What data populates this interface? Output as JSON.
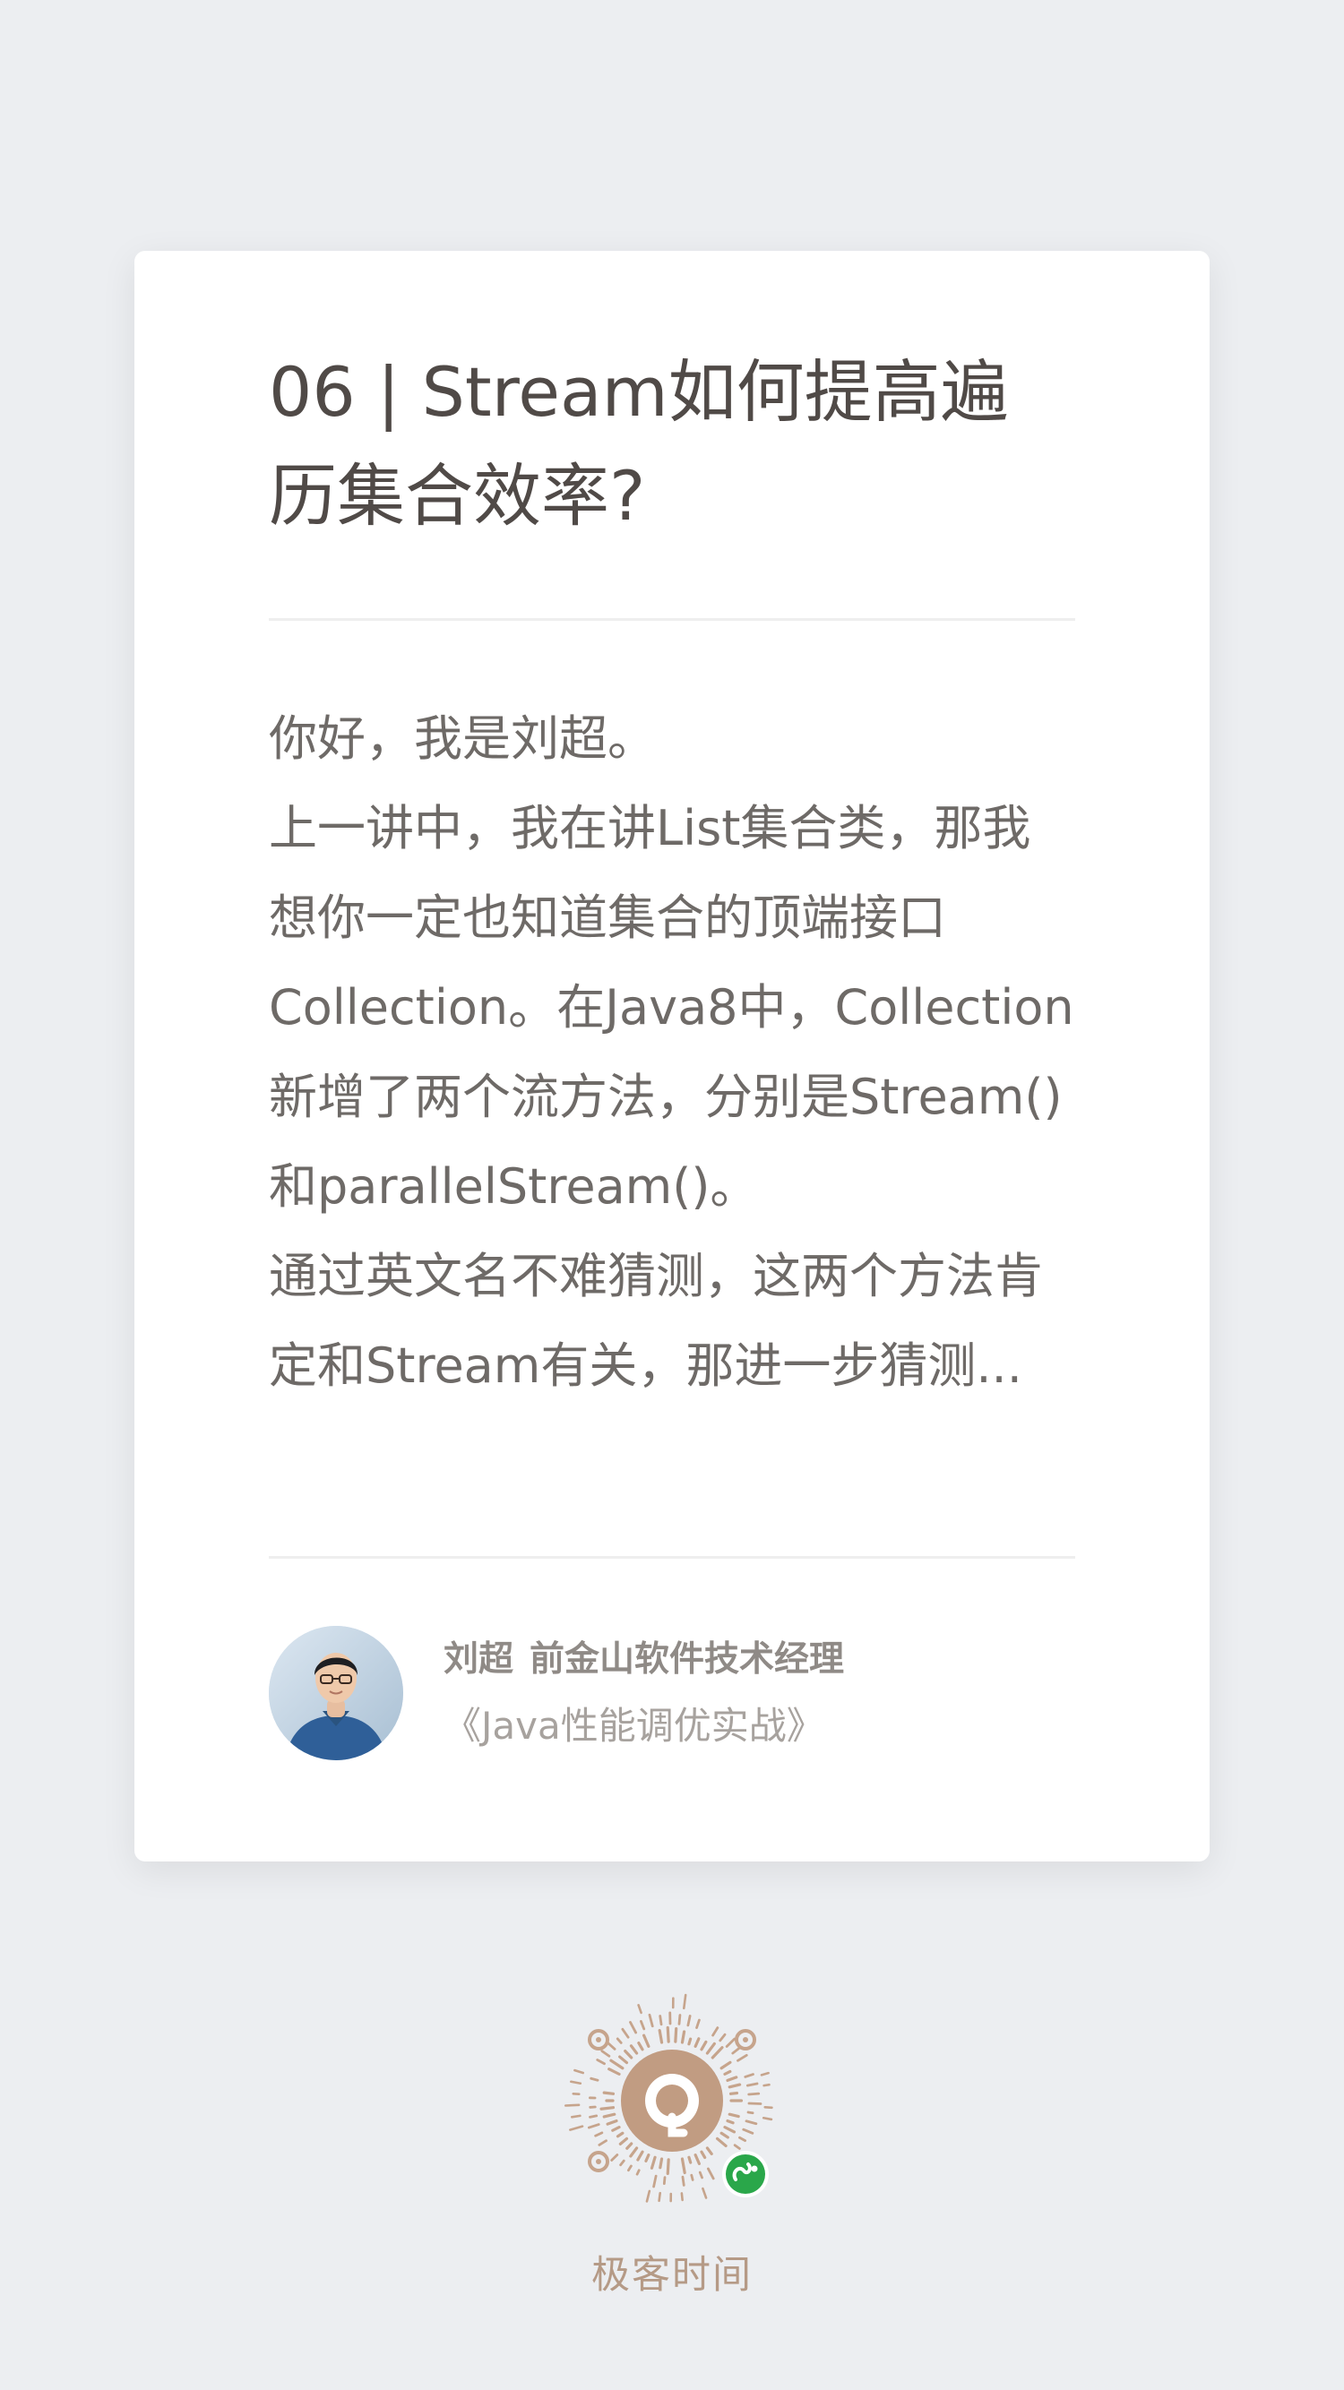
{
  "card": {
    "title": "06 | Stream如何提高遍\n历集合效率?",
    "body": "你好，我是刘超。\n上一讲中，我在讲List集合类，那我\n想你一定也知道集合的顶端接口\nCollection。在Java8中，Collection\n新增了两个流方法，分别是Stream()\n和parallelStream()。\n通过英文名不难猜测，这两个方法肯\n定和Stream有关，那进一步猜测...",
    "author": {
      "name": "刘超",
      "role": "前金山软件技术经理",
      "course": "《Java性能调优实战》"
    }
  },
  "footer": {
    "brand": "极客时间",
    "qr_icon": "miniprogram-qr-code-icon"
  },
  "colors": {
    "background": "#eceef1",
    "card": "#ffffff",
    "title": "#504a47",
    "body": "#6e6a67",
    "brand": "#b59a86",
    "badge": "#2aa74a"
  }
}
